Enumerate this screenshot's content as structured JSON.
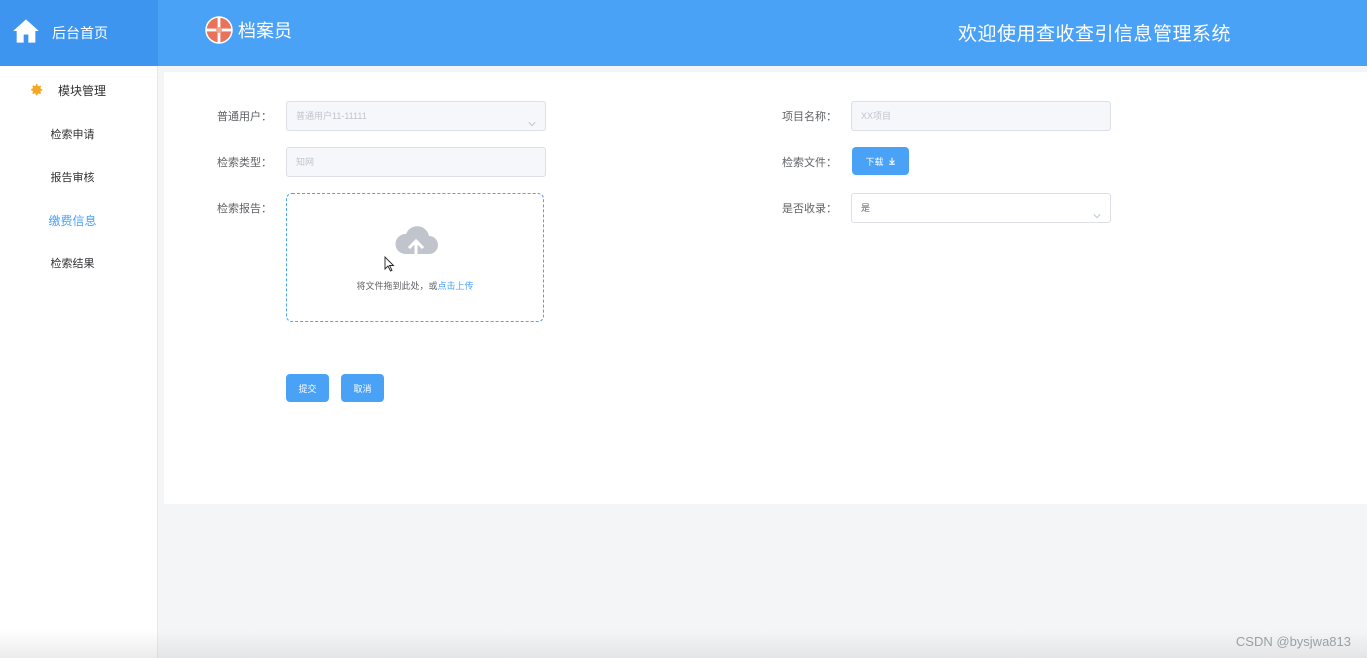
{
  "header": {
    "home_label": "后台首页",
    "home_icon": "home-icon",
    "brand_name": "档案员",
    "brand_icon": "logo-icon",
    "welcome_text": "欢迎使用查收查引信息管理系统",
    "bg_color": "#4aa2f7"
  },
  "sidebar": {
    "group_label": "模块管理",
    "group_icon": "gear-icon",
    "items": [
      {
        "label": "检索申请",
        "active": false
      },
      {
        "label": "报告审核",
        "active": false
      },
      {
        "label": "缴费信息",
        "active": true
      },
      {
        "label": "检索结果",
        "active": false
      }
    ]
  },
  "form": {
    "user": {
      "label": "普通用户：",
      "value": "普通用户11-11111"
    },
    "project": {
      "label": "项目名称：",
      "placeholder": "XX项目"
    },
    "search_type": {
      "label": "检索类型：",
      "placeholder": "知网"
    },
    "search_file": {
      "label": "检索文件：",
      "button_label": "下载"
    },
    "report": {
      "label": "检索报告：",
      "upload_text": "将文件拖到此处，或",
      "upload_link": "点击上传"
    },
    "included": {
      "label": "是否收录：",
      "value": "是"
    },
    "submit_label": "提交",
    "cancel_label": "取消"
  },
  "watermark": "CSDN @bysjwa813",
  "accent_color": "#4aa2f7"
}
